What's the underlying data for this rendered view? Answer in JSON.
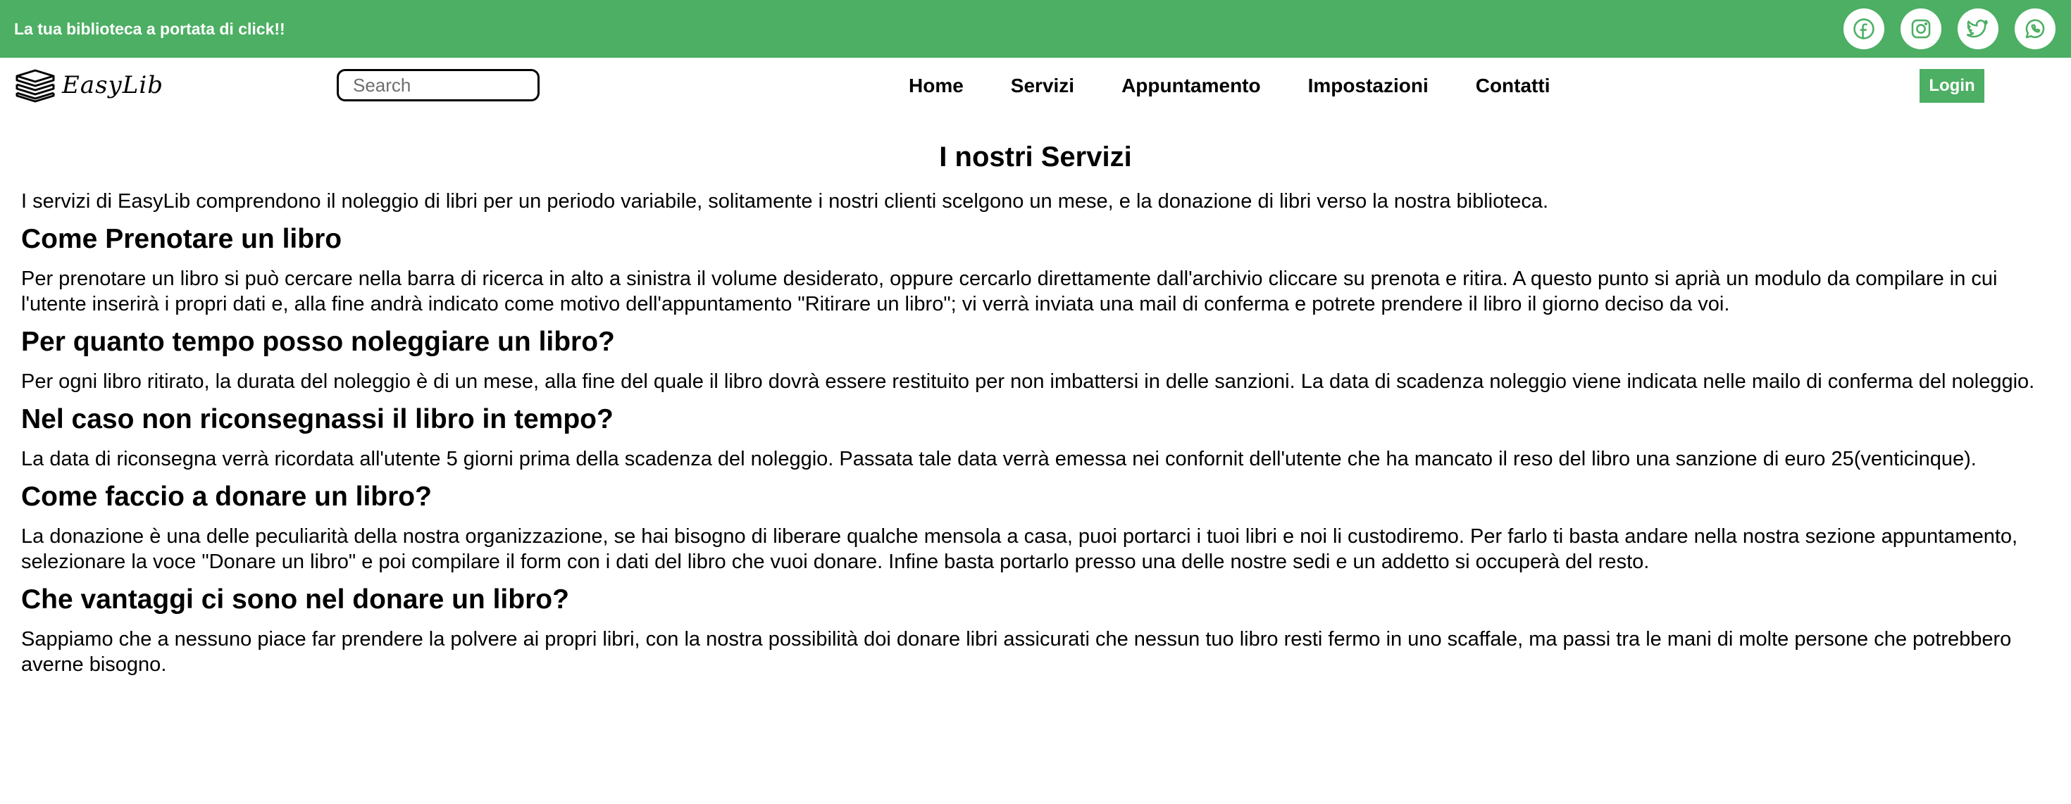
{
  "topbar": {
    "tagline": "La tua biblioteca a portata di click!!",
    "background": "#4caf63",
    "socials": [
      {
        "icon": "facebook-icon"
      },
      {
        "icon": "instagram-icon"
      },
      {
        "icon": "twitter-icon"
      },
      {
        "icon": "whatsapp-icon"
      }
    ]
  },
  "navbar": {
    "logo_text": "EasyLib",
    "search_placeholder": "Search",
    "links": [
      "Home",
      "Servizi",
      "Appuntamento",
      "Impostazioni",
      "Contatti"
    ],
    "login_label": "Login",
    "accent": "#4caf63"
  },
  "main": {
    "title": "I nostri Servizi",
    "intro": "I servizi di EasyLib comprendono il noleggio di libri per un periodo variabile, solitamente i nostri clienti scelgono un mese, e la donazione di libri verso la nostra biblioteca.",
    "sections": [
      {
        "heading": "Come Prenotare un libro",
        "text": "Per prenotare un libro si può cercare nella barra di ricerca in alto a sinistra il volume desiderato, oppure cercarlo direttamente dall'archivio cliccare su prenota e ritira. A questo punto si aprià un modulo da compilare in cui l'utente inserirà i propri dati e, alla fine andrà indicato come motivo dell'appuntamento \"Ritirare un libro\"; vi verrà inviata una mail di conferma e potrete prendere il libro il giorno deciso da voi."
      },
      {
        "heading": "Per quanto tempo posso noleggiare un libro?",
        "text": "Per ogni libro ritirato, la durata del noleggio è di un mese, alla fine del quale il libro dovrà essere restituito per non imbattersi in delle sanzioni. La data di scadenza noleggio viene indicata nelle mailo di conferma del noleggio."
      },
      {
        "heading": "Nel caso non riconsegnassi il libro in tempo?",
        "text": "La data di riconsegna verrà ricordata all'utente 5 giorni prima della scadenza del noleggio. Passata tale data verrà emessa nei confornit dell'utente che ha mancato il reso del libro una sanzione di euro 25(venticinque)."
      },
      {
        "heading": "Come faccio a donare un libro?",
        "text": "La donazione è una delle peculiarità della nostra organizzazione, se hai bisogno di liberare qualche mensola a casa, puoi portarci i tuoi libri e noi li custodiremo. Per farlo ti basta andare nella nostra sezione appuntamento, selezionare la voce \"Donare un libro\" e poi compilare il form con i dati del libro che vuoi donare. Infine basta portarlo presso una delle nostre sedi e un addetto si occuperà del resto."
      },
      {
        "heading": "Che vantaggi ci sono nel donare un libro?",
        "text": "Sappiamo che a nessuno piace far prendere la polvere ai propri libri, con la nostra possibilità doi donare libri assicurati che nessun tuo libro resti fermo in uno scaffale, ma passi tra le mani di molte persone che potrebbero averne bisogno."
      }
    ]
  }
}
